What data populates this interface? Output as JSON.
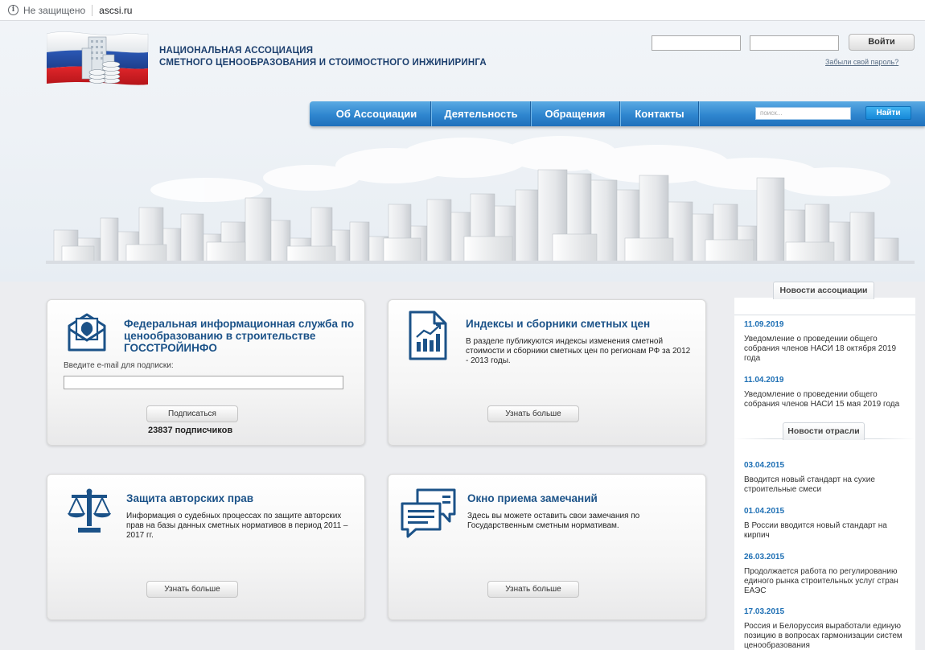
{
  "browser": {
    "security_text": "Не защищено",
    "url": "ascsi.ru"
  },
  "header": {
    "org_name_line1": "НАЦИОНАЛЬНАЯ АССОЦИАЦИЯ",
    "org_name_line2": "СМЕТНОГО ЦЕНООБРАЗОВАНИЯ И СТОИМОСТНОГО ИНЖИНИРИНГА",
    "login_button": "Войти",
    "forgot_password": "Забыли свой пароль?"
  },
  "nav": {
    "items": [
      "Об Ассоциации",
      "Деятельность",
      "Обращения",
      "Контакты"
    ],
    "search_placeholder": "поиск...",
    "search_button": "Найти"
  },
  "cards": {
    "gosstroy": {
      "title_line1": "Федеральная информационная служба по",
      "title_line2": "ценообразованию в строительстве",
      "title_line3": "ГОССТРОЙИНФО",
      "email_label": "Введите e-mail для подписки:",
      "subscribe_button": "Подписаться",
      "subscribers": "23837 подписчиков"
    },
    "indexes": {
      "title": "Индексы и сборники сметных цен",
      "text_line1": "В разделе публикуются индексы изменения сметной",
      "text_line2": "стоимости и сборники сметных цен по регионам РФ за 2012",
      "text_line3": "- 2013 годы.",
      "button": "Узнать больше"
    },
    "copyright": {
      "title": "Защита авторских прав",
      "text_line1": "Информация о судебных процессах по защите авторских",
      "text_line2": "прав на базы данных сметных нормативов в период 2011 –",
      "text_line3": "2017 гг.",
      "button": "Узнать больше"
    },
    "feedback": {
      "title": "Окно приема замечаний",
      "text_line1": "Здесь вы можете оставить свои замечания по",
      "text_line2": "Государственным сметным нормативам.",
      "button": "Узнать больше"
    }
  },
  "news": {
    "association_tab": "Новости ассоциации",
    "association_items": [
      {
        "date": "11.09.2019",
        "text_line1": "Уведомление о проведении общего",
        "text_line2": "собрания членов НАСИ 18 октября 2019",
        "text_line3": "года"
      },
      {
        "date": "11.04.2019",
        "text_line1": "Уведомление о проведении общего",
        "text_line2": "собрания членов НАСИ 15 мая 2019 года"
      }
    ],
    "industry_tab": "Новости отрасли",
    "industry_items": [
      {
        "date": "03.04.2015",
        "text_line1": "Вводится новый стандарт на сухие",
        "text_line2": "строительные смеси"
      },
      {
        "date": "01.04.2015",
        "text_line1": "В России вводится новый стандарт на",
        "text_line2": "кирпич"
      },
      {
        "date": "26.03.2015",
        "text_line1": "Продолжается работа по регулированию",
        "text_line2": "единого рынка строительных услуг стран",
        "text_line3": "ЕАЭС"
      },
      {
        "date": "17.03.2015",
        "text_line1": "Россия и Белоруссия выработали единую",
        "text_line2": "позицию в вопросах гармонизации систем",
        "text_line3": "ценообразования"
      }
    ]
  },
  "colors": {
    "brand_blue": "#1b5288",
    "nav_blue": "#2f86cf",
    "news_date": "#1d6fb4"
  }
}
